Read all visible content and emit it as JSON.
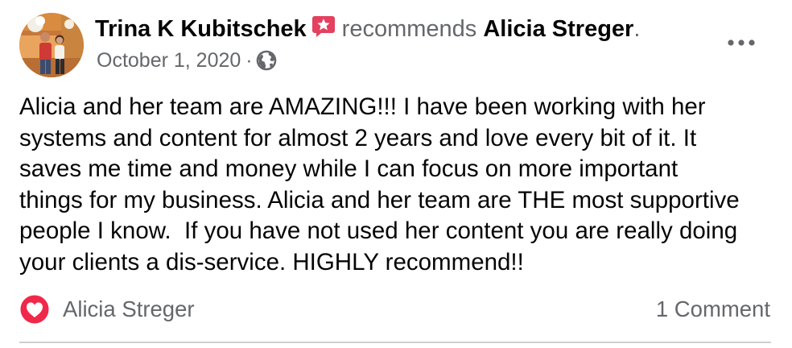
{
  "post": {
    "author": "Trina K Kubitschek",
    "verb": "recommends",
    "target": "Alicia Streger",
    "period": ".",
    "date": "October 1, 2020",
    "separator": "·",
    "privacy_icon": "globe-icon",
    "badge_icon": "recommendation-star-icon",
    "more_icon": "more-options-icon",
    "body": "Alicia and her team are AMAZING!!! I have been working with her\nsystems and content for almost 2 years and love every bit of it. It\nsaves me time and money while I can focus on more important\nthings for my business. Alicia and her team are THE most supportive\npeople I know.  If you have not used her content you are really doing\nyour clients a dis-service. HIGHLY recommend!!"
  },
  "reactions": {
    "icon": "love-heart-icon",
    "reactor": "Alicia Streger",
    "comments": "1 Comment"
  },
  "colors": {
    "text_primary": "#050505",
    "text_secondary": "#65676b",
    "badge": "#e4405f",
    "love_reaction": "#f0284a",
    "divider": "#ced0d4"
  }
}
